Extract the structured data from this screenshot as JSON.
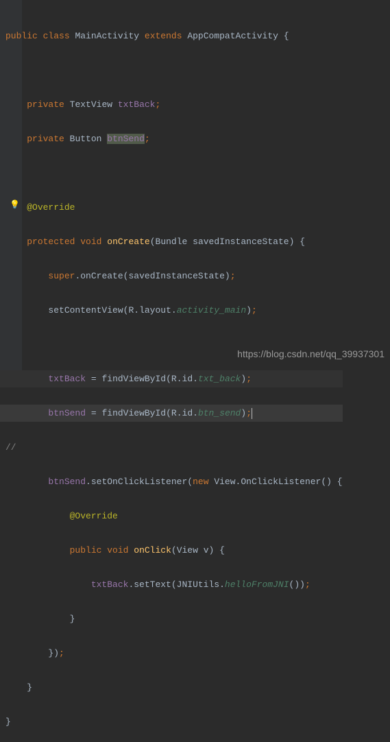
{
  "watermark": "https://blog.csdn.net/qq_39937301",
  "tokens": {
    "public": "public",
    "class": "class",
    "MainActivity": "MainActivity",
    "extends": "extends",
    "AppCompatActivity": "AppCompatActivity",
    "private": "private",
    "TextView": "TextView",
    "txtBack": "txtBack",
    "Button": "Button",
    "btnSend": "btnSend",
    "Override": "@Override",
    "protected": "protected",
    "void": "void",
    "onCreate": "onCreate",
    "Bundle": "Bundle",
    "savedInstanceState": "savedInstanceState",
    "super": "super",
    "setContentView": "setContentView",
    "R": "R",
    "layout": "layout",
    "activity_main": "activity_main",
    "findViewById": "findViewById",
    "id": "id",
    "txt_back": "txt_back",
    "btn_send": "btn_send",
    "setOnClickListener": "setOnClickListener",
    "new": "new",
    "View": "View",
    "OnClickListener": "OnClickListener",
    "onClick": "onClick",
    "v": "v",
    "setText": "setText",
    "JNIUtils": "JNIUtils",
    "helloFromJNI": "helloFromJNI",
    "comment": "//"
  }
}
